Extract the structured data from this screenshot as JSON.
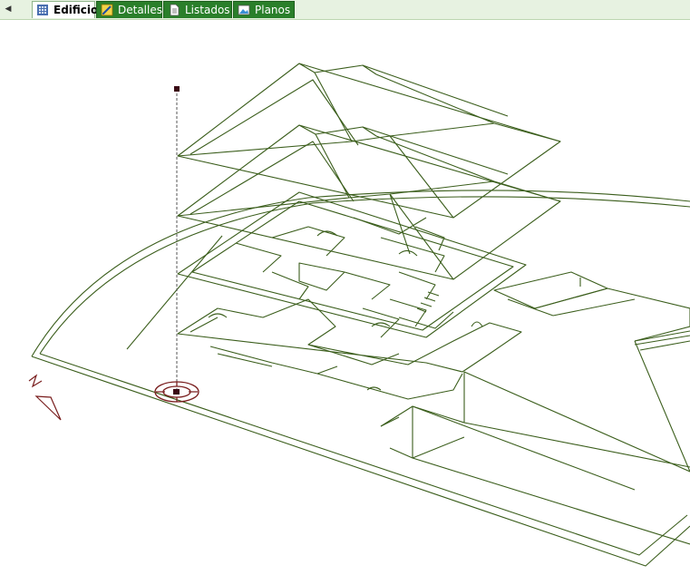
{
  "tabs": [
    {
      "label": "Edificio",
      "icon": "building-grid-icon",
      "active": true
    },
    {
      "label": "Detalles",
      "icon": "details-edit-icon",
      "active": false
    },
    {
      "label": "Listados",
      "icon": "document-list-icon",
      "active": false
    },
    {
      "label": "Planos",
      "icon": "plans-image-icon",
      "active": false
    }
  ],
  "view": {
    "line_color": "#3b5e1c",
    "camera_color": "#7a1f1f",
    "north_label": "N"
  }
}
